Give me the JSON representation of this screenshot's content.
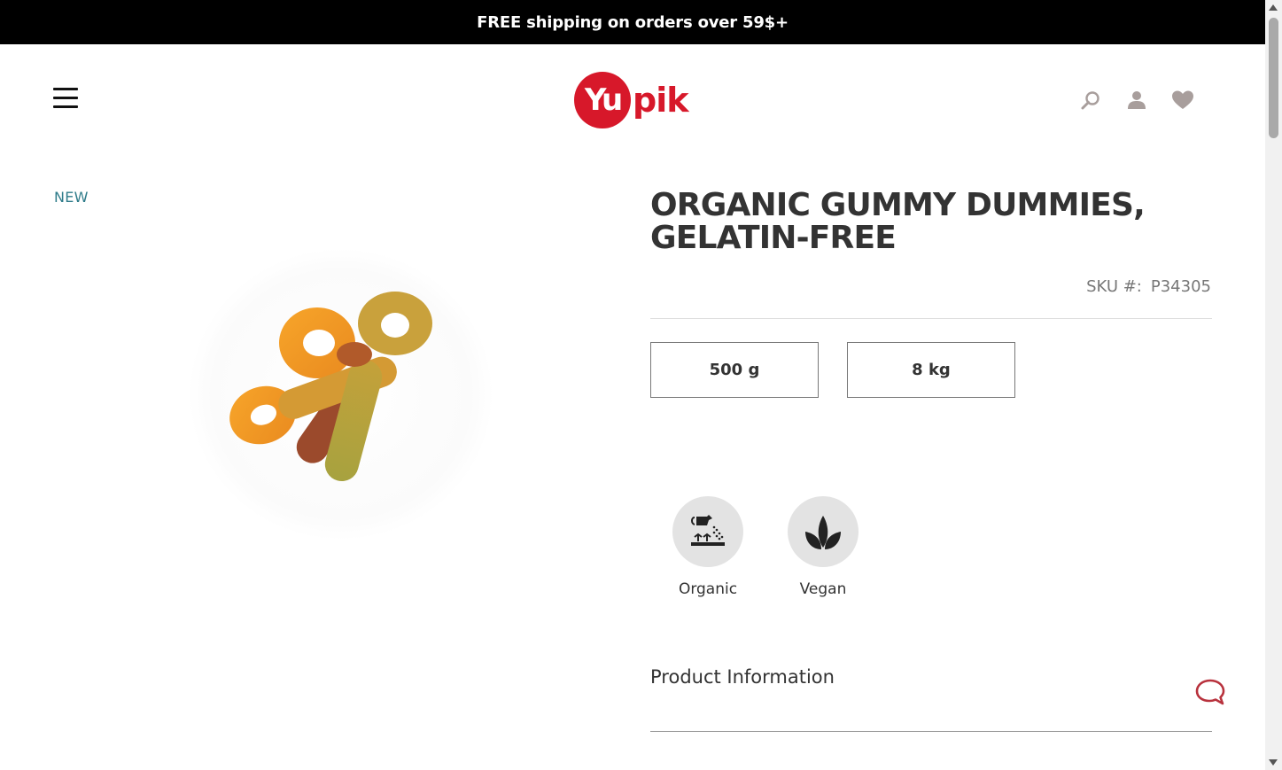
{
  "promo": {
    "text": "FREE shipping on orders over 59$+"
  },
  "header": {
    "logo_mark": "Yu",
    "logo_text": "pik",
    "icons": [
      "menu-icon",
      "search-icon",
      "account-icon",
      "heart-icon"
    ]
  },
  "product": {
    "badge": "NEW",
    "title": "ORGANIC GUMMY DUMMIES, GELATIN-FREE",
    "sku_label": "SKU #:",
    "sku_value": "P34305",
    "sizes": [
      "500 g",
      "8 kg"
    ],
    "attributes": [
      {
        "label": "Organic",
        "icon": "watering-can-icon"
      },
      {
        "label": "Vegan",
        "icon": "leaves-icon"
      }
    ],
    "accordion_title": "Product Information"
  },
  "colors": {
    "brand_red": "#d7182a",
    "badge_teal": "#2f7c8a",
    "icon_gray": "#a89e9c"
  }
}
